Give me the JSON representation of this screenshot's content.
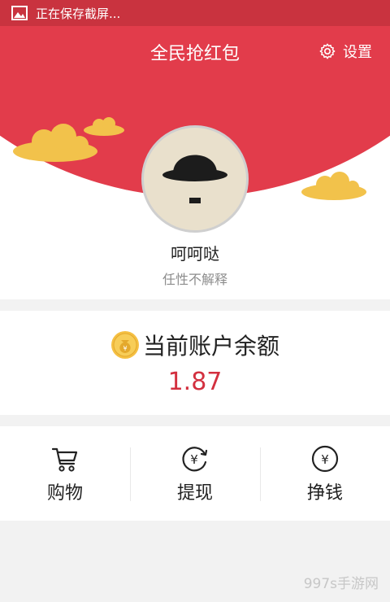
{
  "status_bar": {
    "notification_text": "正在保存截屏..."
  },
  "header": {
    "title": "全民抢红包",
    "settings_label": "设置"
  },
  "profile": {
    "username": "呵呵哒",
    "signature": "任性不解释"
  },
  "balance": {
    "label": "当前账户余额",
    "amount": "1.87"
  },
  "actions": [
    {
      "label": "购物",
      "icon": "cart-icon"
    },
    {
      "label": "提现",
      "icon": "yen-refresh-icon"
    },
    {
      "label": "挣钱",
      "icon": "yen-circle-icon"
    }
  ],
  "watermark": "997s手游网",
  "colors": {
    "brand_red": "#e23c4b",
    "status_bar": "#c9333f",
    "amount_red": "#d3303f",
    "cloud_yellow": "#f2c24b"
  }
}
